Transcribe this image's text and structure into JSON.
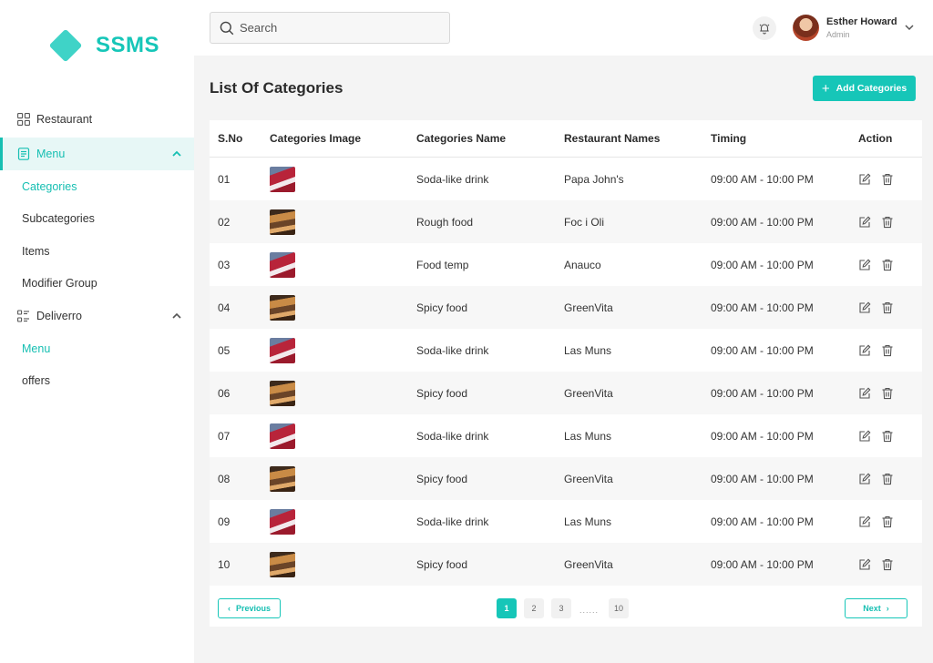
{
  "brand": {
    "name": "SSMS",
    "accent": "#16c6b8"
  },
  "sidebar": {
    "items": [
      {
        "label": "Restaurant",
        "icon": "grid-icon"
      },
      {
        "label": "Menu",
        "icon": "document-icon",
        "expanded": true,
        "active": true,
        "children": [
          "Categories",
          "Subcategories",
          "Items",
          "Modifier Group"
        ]
      },
      {
        "label": "Deliverro",
        "icon": "list-icon",
        "expanded": true,
        "children": [
          "Menu",
          "offers"
        ]
      }
    ]
  },
  "topbar": {
    "search_placeholder": "Search",
    "user": {
      "name": "Esther Howard",
      "role": "Admin"
    }
  },
  "main": {
    "title": "List Of Categories",
    "add_button": "Add Categories",
    "table": {
      "headers": [
        "S.No",
        "Categories Image",
        "Categories Name",
        "Restaurant Names",
        "Timing",
        "Action"
      ],
      "rows": [
        {
          "sno": "01",
          "image": "red",
          "name": "Soda-like drink",
          "restaurant": "Papa John's",
          "timing": "09:00 AM - 10:00 PM"
        },
        {
          "sno": "02",
          "image": "brown",
          "name": "Rough food",
          "restaurant": "Foc i Oli",
          "timing": "09:00 AM - 10:00 PM"
        },
        {
          "sno": "03",
          "image": "red",
          "name": "Food temp",
          "restaurant": "Anauco",
          "timing": "09:00 AM - 10:00 PM"
        },
        {
          "sno": "04",
          "image": "brown",
          "name": "Spicy food",
          "restaurant": "GreenVita",
          "timing": "09:00 AM - 10:00 PM"
        },
        {
          "sno": "05",
          "image": "red",
          "name": "Soda-like drink",
          "restaurant": "Las Muns",
          "timing": "09:00 AM - 10:00 PM"
        },
        {
          "sno": "06",
          "image": "brown",
          "name": "Spicy food",
          "restaurant": "GreenVita",
          "timing": "09:00 AM - 10:00 PM"
        },
        {
          "sno": "07",
          "image": "red",
          "name": "Soda-like drink",
          "restaurant": "Las Muns",
          "timing": "09:00 AM - 10:00 PM"
        },
        {
          "sno": "08",
          "image": "brown",
          "name": "Spicy food",
          "restaurant": "GreenVita",
          "timing": "09:00 AM - 10:00 PM"
        },
        {
          "sno": "09",
          "image": "red",
          "name": "Soda-like drink",
          "restaurant": "Las Muns",
          "timing": "09:00 AM - 10:00 PM"
        },
        {
          "sno": "10",
          "image": "brown",
          "name": "Spicy food",
          "restaurant": "GreenVita",
          "timing": "09:00 AM - 10:00 PM"
        }
      ]
    },
    "pagination": {
      "previous": "Previous",
      "next": "Next",
      "pages": [
        "1",
        "2",
        "3",
        "10"
      ],
      "current": "1",
      "ellipsis": "......"
    }
  }
}
